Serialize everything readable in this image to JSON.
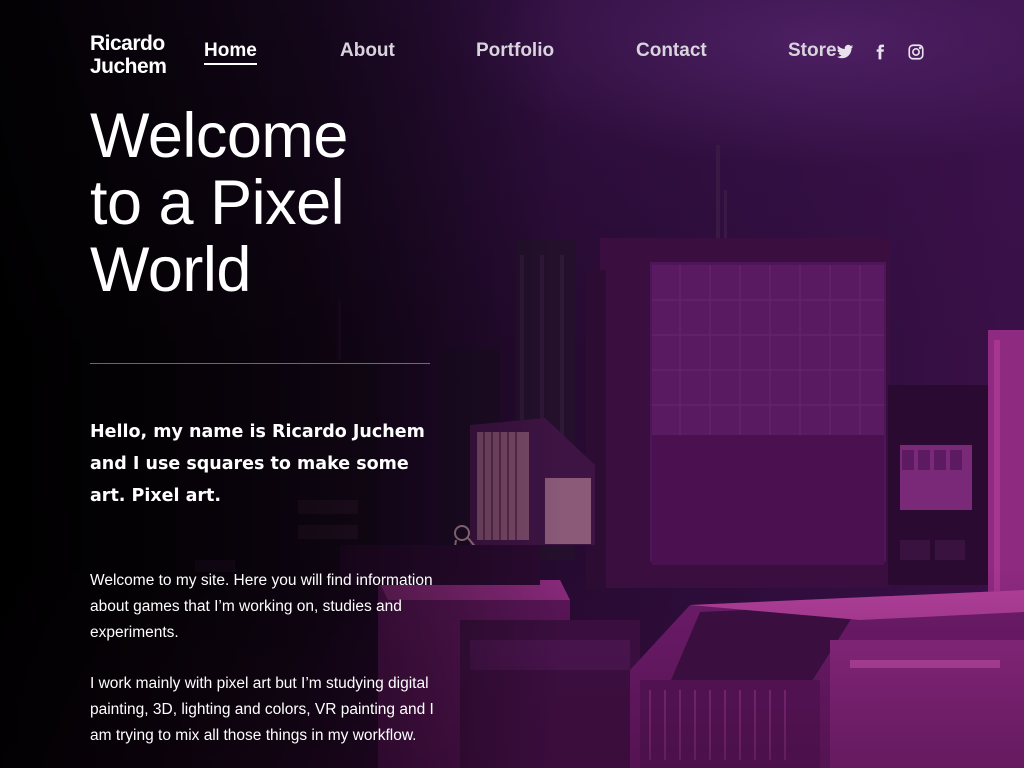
{
  "header": {
    "logo_line1": "Ricardo",
    "logo_line2": "Juchem",
    "nav": {
      "home": "Home",
      "about": "About",
      "portfolio": "Portfolio",
      "contact": "Contact",
      "store": "Store"
    },
    "social": [
      "twitter-icon",
      "facebook-icon",
      "instagram-icon"
    ]
  },
  "hero": {
    "title_line1": "Welcome",
    "title_line2": "to a Pixel",
    "title_line3": "World",
    "intro_before": "Hello, my name is ",
    "intro_name": "Ricardo Juchem",
    "intro_after": " and I use squares to make some art. Pixel art.",
    "paragraph1": "Welcome to my site. Here you will find information about games that I’m working on, studies and experiments.",
    "paragraph2": "I work mainly with pixel art but I’m studying digital painting, 3D, lighting and colors, VR painting and I am trying to mix all those things in my workflow."
  },
  "colors": {
    "accent": "#c8399a",
    "background_dark": "#0a020c",
    "building_magenta": "#8a1f7a"
  }
}
